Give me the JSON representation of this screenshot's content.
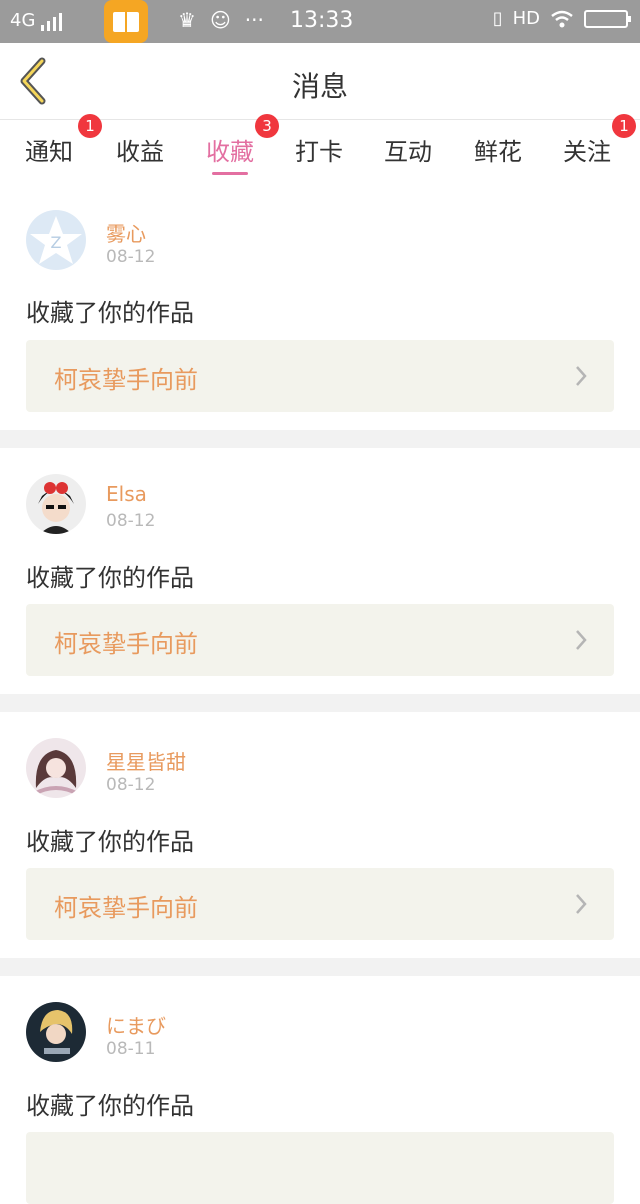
{
  "statusbar": {
    "network": "4G",
    "time": "13:33",
    "hd": "HD"
  },
  "header": {
    "title": "消息"
  },
  "tabs": [
    {
      "label": "通知",
      "badge": "1"
    },
    {
      "label": "收益",
      "badge": ""
    },
    {
      "label": "收藏",
      "badge": "3",
      "active": true
    },
    {
      "label": "打卡",
      "badge": ""
    },
    {
      "label": "互动",
      "badge": ""
    },
    {
      "label": "鲜花",
      "badge": ""
    },
    {
      "label": "关注",
      "badge": "1"
    }
  ],
  "messages": [
    {
      "name": "雾心",
      "date": "08-12",
      "text": "收藏了你的作品",
      "work": "柯哀挚手向前"
    },
    {
      "name": "Elsa",
      "date": "08-12",
      "text": "收藏了你的作品",
      "work": "柯哀挚手向前"
    },
    {
      "name": "星星皆甜",
      "date": "08-12",
      "text": "收藏了你的作品",
      "work": "柯哀挚手向前"
    },
    {
      "name": "にまび",
      "date": "08-11",
      "text": "收藏了你的作品",
      "work": ""
    }
  ],
  "colors": {
    "accent_pink": "#e36fa1",
    "accent_orange": "#e89a5e",
    "badge_red": "#f0373e"
  }
}
